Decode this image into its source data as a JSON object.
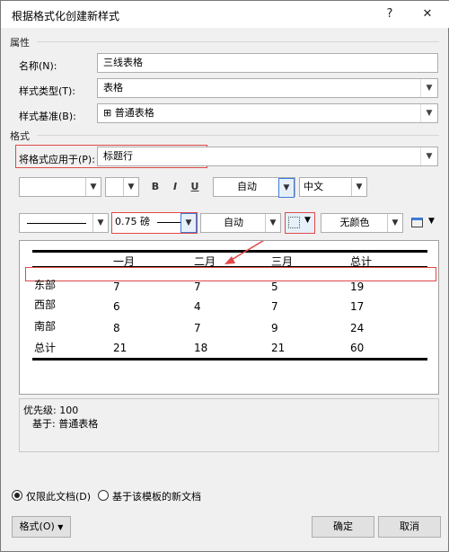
{
  "window": {
    "title": "根据格式化创建新样式",
    "help": "?",
    "close": "✕"
  },
  "properties": {
    "section_label": "属性",
    "name_label": "名称(N):",
    "name_value": "三线表格",
    "type_label": "样式类型(T):",
    "type_value": "表格",
    "base_label": "样式基准(B):",
    "base_value": "⊞ 普通表格"
  },
  "format": {
    "section_label": "格式",
    "apply_label": "将格式应用于(P):",
    "apply_value": "标题行",
    "font_size": "",
    "bold": "B",
    "italic": "I",
    "underline": "U",
    "color": "自动",
    "lang": "中文",
    "border_width": "0.75 磅",
    "border_color": "自动",
    "shading": "无颜色"
  },
  "preview": {
    "headers": [
      "一月",
      "二月",
      "三月",
      "总计"
    ],
    "rows": [
      [
        "东部",
        "7",
        "7",
        "5",
        "19"
      ],
      [
        "西部",
        "6",
        "4",
        "7",
        "17"
      ],
      [
        "南部",
        "8",
        "7",
        "9",
        "24"
      ],
      [
        "总计",
        "21",
        "18",
        "21",
        "60"
      ]
    ]
  },
  "description": {
    "line1": "优先级: 100",
    "line2": "基于: 普通表格"
  },
  "options": {
    "radio1": "仅限此文档(D)",
    "radio2": "基于该模板的新文档"
  },
  "buttons": {
    "format": "格式(O)",
    "ok": "确定",
    "cancel": "取消"
  },
  "colors": {
    "annotation": "#e04848",
    "accent": "#3b7bd8"
  }
}
